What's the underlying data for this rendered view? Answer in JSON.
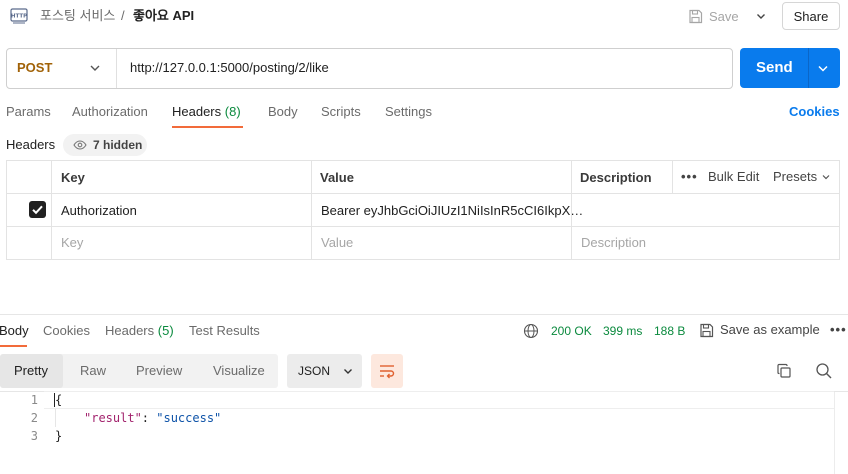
{
  "topbar": {
    "breadcrumb_parent": "포스팅 서비스",
    "breadcrumb_separator": "/",
    "breadcrumb_current": "좋아요 API",
    "save_label": "Save",
    "share_label": "Share"
  },
  "request": {
    "method": "POST",
    "url": "http://127.0.0.1:5000/posting/2/like",
    "send_label": "Send"
  },
  "request_tabs": {
    "params": "Params",
    "authorization": "Authorization",
    "headers": "Headers",
    "headers_count": "(8)",
    "body": "Body",
    "scripts": "Scripts",
    "settings": "Settings",
    "cookies": "Cookies"
  },
  "headers_section": {
    "label": "Headers",
    "hidden_count": "7 hidden",
    "col_key": "Key",
    "col_value": "Value",
    "col_description": "Description",
    "bulk_edit": "Bulk Edit",
    "presets": "Presets",
    "rows": [
      {
        "key": "Authorization",
        "value": "Bearer eyJhbGciOiJIUzI1NiIsInR5cCI6IkpX…",
        "description": "",
        "checked": true
      }
    ],
    "placeholder": {
      "key": "Key",
      "value": "Value",
      "description": "Description"
    }
  },
  "response": {
    "tabs": {
      "body": "Body",
      "cookies": "Cookies",
      "headers": "Headers",
      "headers_count": "(5)",
      "test_results": "Test Results"
    },
    "status": "200 OK",
    "time": "399 ms",
    "size": "188 B",
    "save_example": "Save as example",
    "view_tabs": {
      "pretty": "Pretty",
      "raw": "Raw",
      "preview": "Preview",
      "visualize": "Visualize"
    },
    "format": "JSON",
    "code": [
      {
        "no": "1",
        "open": "{"
      },
      {
        "no": "2",
        "key": "\"result\"",
        "colon": ": ",
        "value": "\"success\""
      },
      {
        "no": "3",
        "close": "}"
      }
    ]
  },
  "colors": {
    "accent": "#f26b3a",
    "send": "#097bed",
    "method": "#a16207",
    "status_ok": "#0b8a3e"
  }
}
